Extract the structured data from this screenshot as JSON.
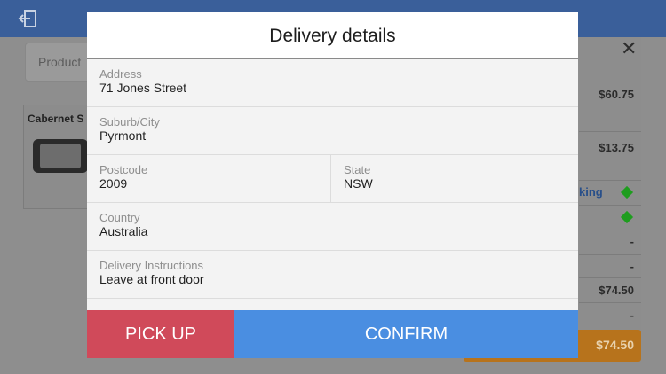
{
  "background": {
    "product_placeholder": "Product",
    "product_name": "Cabernet S",
    "side_values": [
      "$60.75",
      "$13.75",
      "-",
      "-",
      "$74.50",
      "-"
    ],
    "tracking_label": "king",
    "total": "$74.50",
    "close_symbol": "✕"
  },
  "modal": {
    "title": "Delivery details",
    "fields": {
      "address": {
        "label": "Address",
        "value": "71 Jones Street"
      },
      "suburb": {
        "label": "Suburb/City",
        "value": "Pyrmont"
      },
      "postcode": {
        "label": "Postcode",
        "value": "2009"
      },
      "state": {
        "label": "State",
        "value": "NSW"
      },
      "country": {
        "label": "Country",
        "value": "Australia"
      },
      "instructions": {
        "label": "Delivery Instructions",
        "value": "Leave at front door"
      }
    },
    "pickup_label": "PICK UP",
    "confirm_label": "CONFIRM"
  },
  "colors": {
    "pickup": "#d04a5a",
    "confirm": "#4a8ee1",
    "header": "#3a5f9a"
  }
}
